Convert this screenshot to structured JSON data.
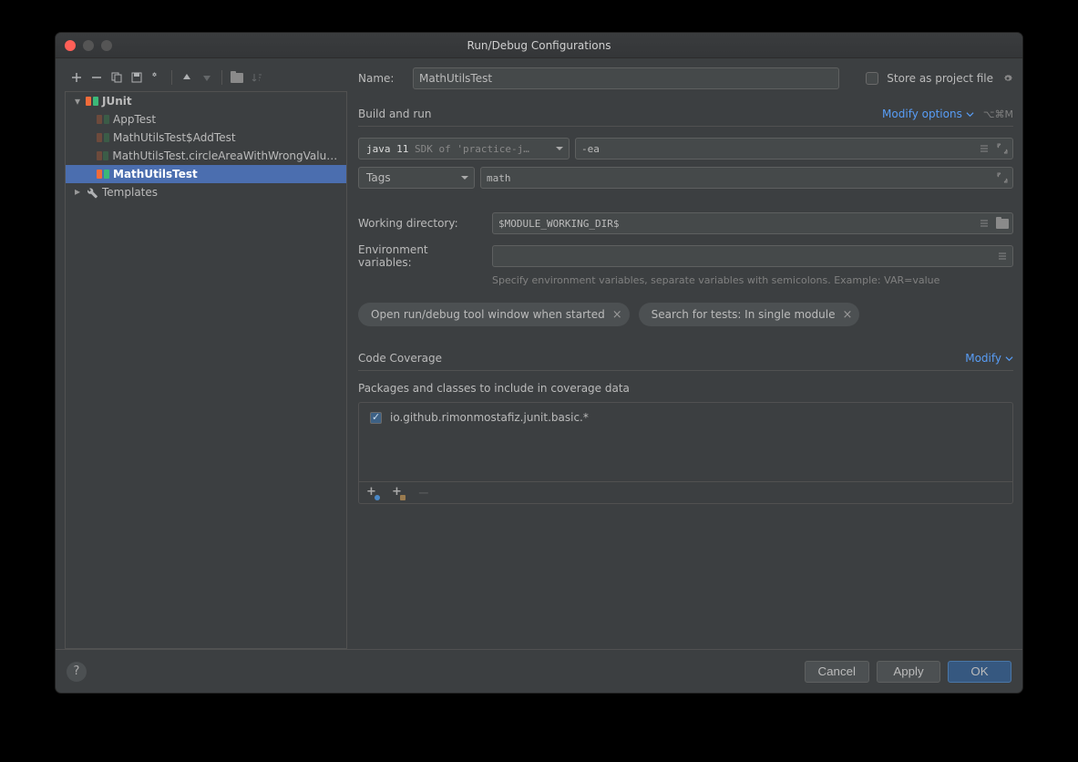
{
  "window": {
    "title": "Run/Debug Configurations"
  },
  "tree": {
    "root_label": "JUnit",
    "items": [
      {
        "label": "AppTest"
      },
      {
        "label": "MathUtilsTest$AddTest"
      },
      {
        "label": "MathUtilsTest.circleAreaWithWrongValueO…"
      },
      {
        "label": "MathUtilsTest",
        "selected": true
      }
    ],
    "templates_label": "Templates"
  },
  "form": {
    "name_label": "Name:",
    "name_value": "MathUtilsTest",
    "store_project_label": "Store as project file",
    "build_section": "Build and run",
    "modify_options": "Modify options",
    "modify_shortcut": "⌥⌘M",
    "jdk_label": "java 11",
    "jdk_sub": "SDK of 'practice-j…",
    "vm_options": "-ea",
    "test_kind": "Tags",
    "tags_value": "math",
    "workdir_label": "Working directory:",
    "workdir_value": "$MODULE_WORKING_DIR$",
    "env_label": "Environment variables:",
    "env_value": "",
    "env_hint": "Specify environment variables, separate variables with semicolons. Example: VAR=value",
    "chip1": "Open run/debug tool window when started",
    "chip2": "Search for tests: In single module",
    "coverage_section": "Code Coverage",
    "modify_label": "Modify",
    "coverage_sub": "Packages and classes to include in coverage data",
    "coverage_item": "io.github.rimonmostafiz.junit.basic.*"
  },
  "footer": {
    "cancel": "Cancel",
    "apply": "Apply",
    "ok": "OK"
  }
}
